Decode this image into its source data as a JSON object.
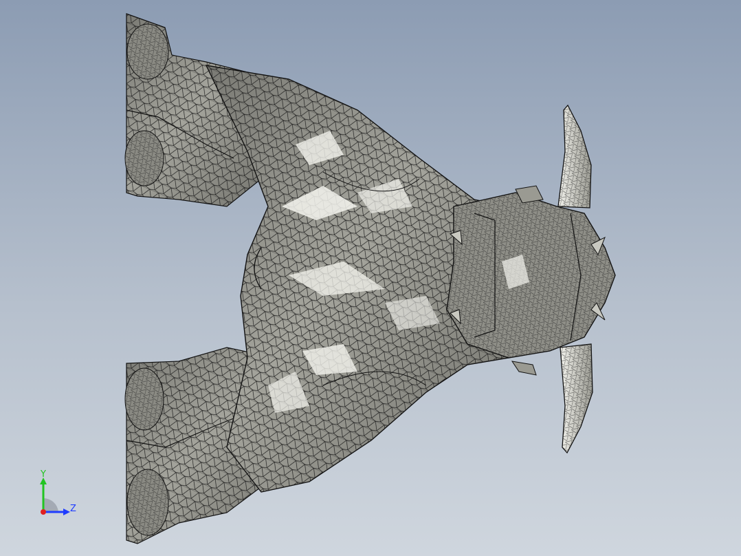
{
  "viewport": {
    "background_top": "#8c9cb3",
    "background_bottom": "#cfd6de"
  },
  "model": {
    "name": "bull-mesh",
    "render_mode": "shaded-with-edges",
    "fill_color": "#8d8d86",
    "highlight_color": "#f4f4ee",
    "edge_color": "#1a1a1a"
  },
  "triad": {
    "x_label": "",
    "y_label": "Y",
    "z_label": "Z",
    "y_color": "#22c422",
    "z_color": "#1f3cff",
    "x_color": "#e02020"
  }
}
